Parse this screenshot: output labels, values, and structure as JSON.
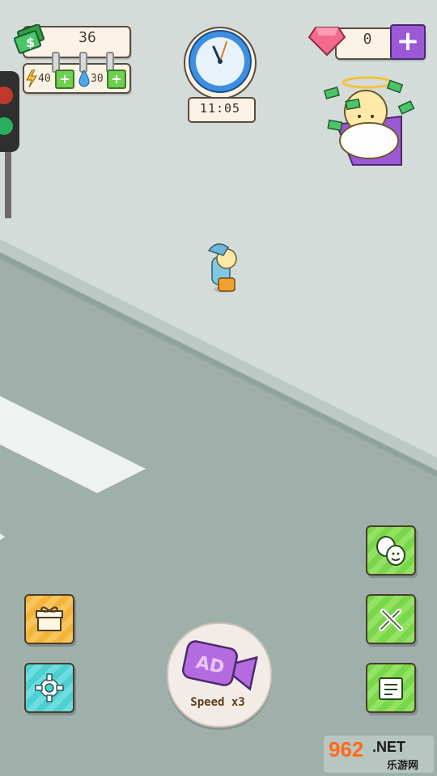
{
  "hud": {
    "money": "36",
    "energy": "40",
    "water": "30",
    "gems": "0",
    "clock_time": "11:05"
  },
  "ad_button": {
    "badge": "AD",
    "label": "Speed x3"
  },
  "side_buttons": {
    "left": [
      "gift-icon",
      "gear-icon"
    ],
    "right": [
      "emotions-icon",
      "tools-icon",
      "quest-card-icon"
    ]
  },
  "watermark": {
    "brand": "962",
    "suffix": ".NET",
    "subtitle": "乐游网"
  },
  "colors": {
    "road": "#9fb0ab",
    "sidewalk": "#d3dcd9",
    "gem_button": "#9b59d6",
    "green_button": "#7ad64a",
    "gift_button": "#f2b43a",
    "settings_button": "#4ecfd0"
  }
}
